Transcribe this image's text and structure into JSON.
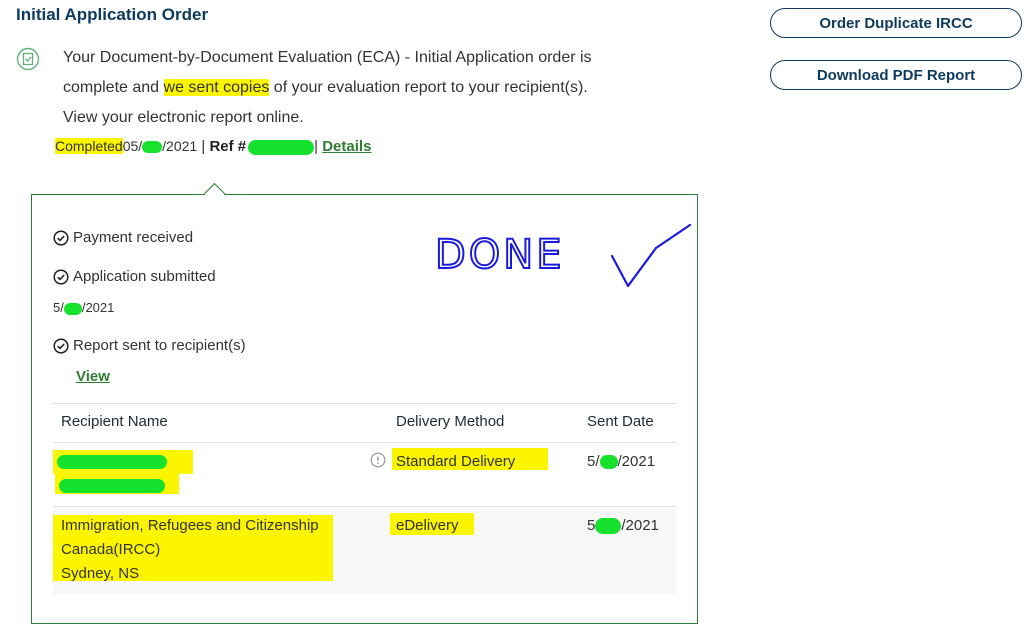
{
  "order": {
    "title": "Initial Application Order",
    "message_lines": [
      "Your Document-by-Document Evaluation (ECA) - Initial Application order is",
      [
        "complete and ",
        "we sent copies",
        " of your evaluation report to your recipient(s)."
      ],
      "View your electronic report online."
    ],
    "completed_label": "Completed",
    "completed_date_prefix": "05/",
    "completed_date_suffix": "/2021",
    "ref_label": "Ref #",
    "details_link": "Details"
  },
  "actions": {
    "order_duplicate": "Order Duplicate IRCC",
    "download_pdf": "Download PDF Report"
  },
  "steps": [
    {
      "label": "Payment received"
    },
    {
      "label": "Application submitted",
      "date_prefix": "5/",
      "date_suffix": "/2021"
    },
    {
      "label": "Report sent to recipient(s)",
      "link": "View"
    }
  ],
  "annotation": {
    "text": "DONE"
  },
  "table": {
    "headers": [
      "Recipient Name",
      "Delivery Method",
      "Sent Date"
    ],
    "rows": [
      {
        "name_lines": [],
        "method": "Standard Delivery",
        "date_prefix": "5/",
        "date_suffix": "/2021"
      },
      {
        "name_lines": [
          "Immigration, Refugees and Citizenship",
          "Canada(IRCC)",
          "Sydney, NS"
        ],
        "method": "eDelivery",
        "date_prefix": "5",
        "date_suffix": "/2021"
      }
    ]
  },
  "colors": {
    "navy": "#0e3a5e",
    "green": "#2e7d32",
    "highlight": "#fbf500",
    "redaction": "#16e22e",
    "pen": "#1a1adc"
  }
}
